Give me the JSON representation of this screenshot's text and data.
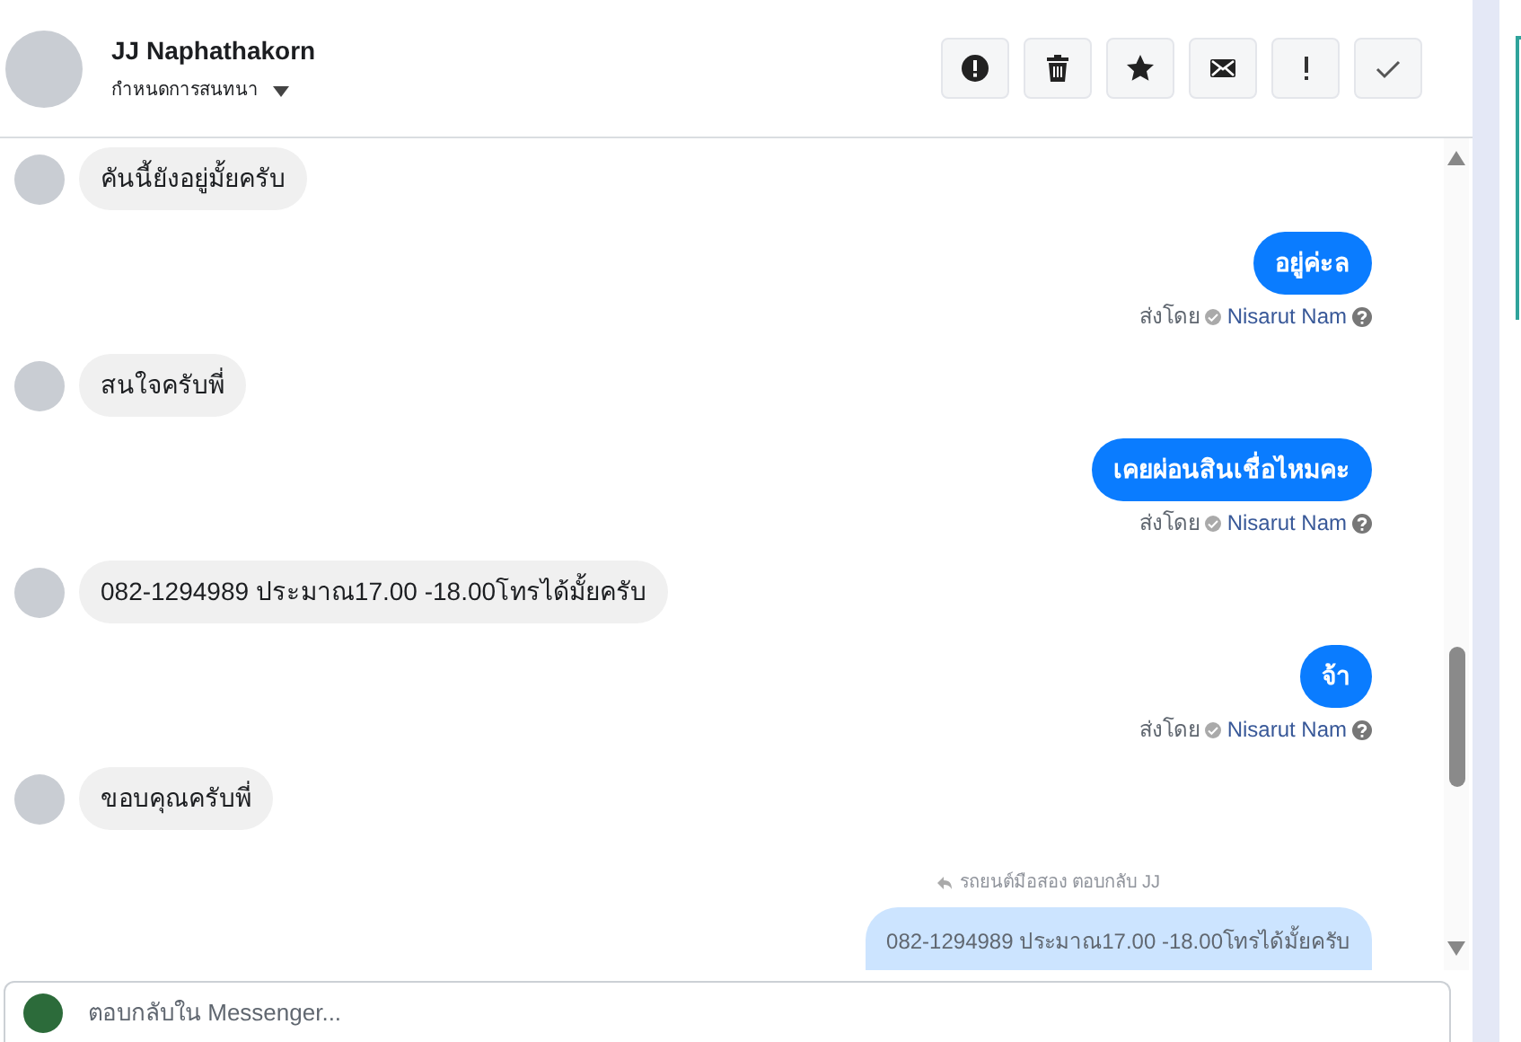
{
  "contact": {
    "name": "JJ Naphathakorn",
    "subtitle": "กำหนดการสนทนา"
  },
  "actions": [
    {
      "kind": "alert"
    },
    {
      "kind": "trash"
    },
    {
      "kind": "star"
    },
    {
      "kind": "mail"
    },
    {
      "kind": "exclaim"
    },
    {
      "kind": "check"
    }
  ],
  "messages": [
    {
      "kind": "incoming",
      "text": "คันนี้ยังอยู่มั้ยครับ"
    },
    {
      "kind": "outgoing",
      "text": "อยู่ค่ะล",
      "sent_by": "ส่งโดย",
      "sender": "Nisarut Nam"
    },
    {
      "kind": "incoming",
      "text": "สนใจครับพี่"
    },
    {
      "kind": "outgoing",
      "text": "เคยผ่อนสินเชื่อไหมคะ",
      "sent_by": "ส่งโดย",
      "sender": "Nisarut Nam"
    },
    {
      "kind": "incoming",
      "text": "082-1294989 ประมาณ17.00 -18.00โทรได้มั้ยครับ"
    },
    {
      "kind": "outgoing",
      "text": "จ้า",
      "sent_by": "ส่งโดย",
      "sender": "Nisarut Nam"
    },
    {
      "kind": "incoming",
      "text": "ขอบคุณครับพี่"
    },
    {
      "kind": "reply",
      "label": "รถยนต์มือสอง ตอบกลับ JJ",
      "quoted": "082-1294989 ประมาณ17.00 -18.00โทรได้มั้ยครับ"
    }
  ],
  "composer": {
    "placeholder": "ตอบกลับใน Messenger..."
  }
}
